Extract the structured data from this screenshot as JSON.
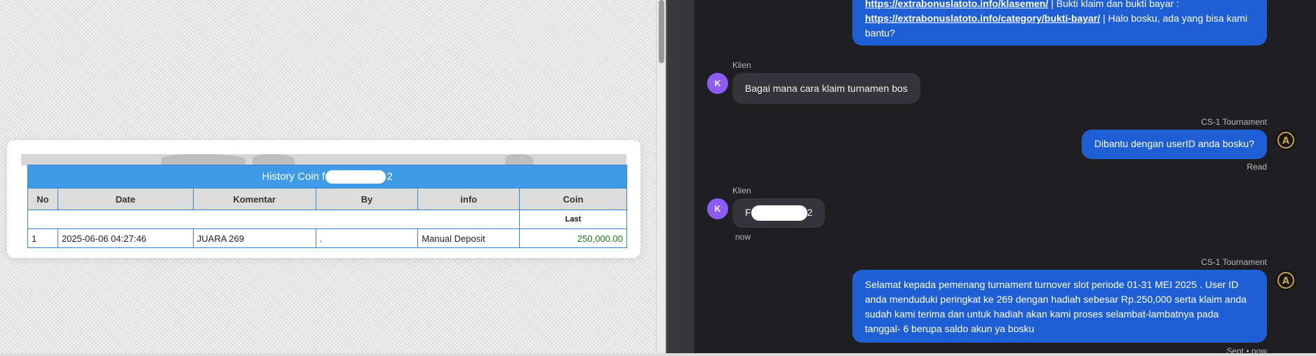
{
  "history_table": {
    "title_prefix": "History Coin f",
    "title_suffix": "2",
    "columns": [
      "No",
      "Date",
      "Komentar",
      "By",
      "info",
      "Coin"
    ],
    "sub_header_coin": "Last",
    "rows": [
      {
        "no": "1",
        "date": "2025-06-06 04:27:46",
        "komentar": "JUARA 269",
        "by": ".",
        "info": "Manual Deposit",
        "coin": "250,000.00"
      }
    ]
  },
  "chat": {
    "top_message": {
      "link1": "https://extrabonuslatoto.info/klasemen/",
      "text1": " | Bukti klaim dan bukti bayar :",
      "link2": "https://extrabonuslatoto.info/category/bukti-bayar/",
      "text2": " | Halo bosku, ada yang bisa kami bantu?"
    },
    "messages": [
      {
        "sender": "Klien",
        "avatar": "K",
        "text": "Bagai mana cara klaim turnamen bos"
      },
      {
        "sender": "CS-1 Tournament",
        "text": "Dibantu dengan userID anda bosku?",
        "status": "Read"
      },
      {
        "sender": "Klien",
        "avatar": "K",
        "text_prefix": "F",
        "text_suffix": "2",
        "time": "now"
      },
      {
        "sender": "CS-1 Tournament",
        "text": "Selamat kepada pemenang turnament turnover slot periode 01-31 MEI 2025 . User ID anda menduduki peringkat ke 269 dengan hadiah sebesar Rp.250,000 serta klaim anda sudah kami terima dan untuk hadiah akan kami proses selambat-lambatnya pada tanggal- 6 berupa saldo akun ya bosku",
        "status": "Sent • now"
      }
    ],
    "agent_avatar_letter": "A"
  },
  "colors": {
    "table_header": "#3f9be6",
    "coin_value": "#1a7a1a",
    "bubble_out": "#1f5fd6",
    "bubble_in": "#34343a",
    "chat_bg": "#1f1f22",
    "avatar_klien": "#8b5cf6"
  }
}
